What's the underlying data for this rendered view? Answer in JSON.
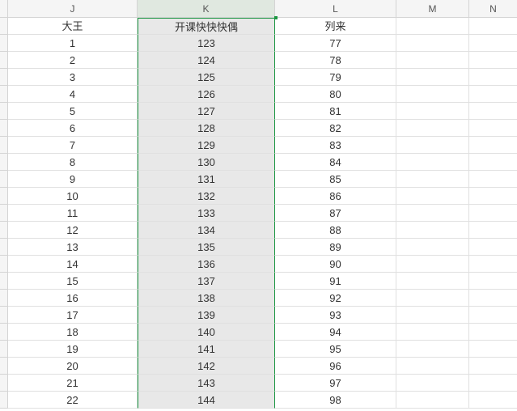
{
  "columns": [
    {
      "letter": "J",
      "selected": false
    },
    {
      "letter": "K",
      "selected": true
    },
    {
      "letter": "L",
      "selected": false
    },
    {
      "letter": "M",
      "selected": false
    },
    {
      "letter": "N",
      "selected": false
    }
  ],
  "headers": {
    "J": "大王",
    "K": "开课快快快偶",
    "L": "列来",
    "M": "",
    "N": ""
  },
  "rows": [
    {
      "J": "1",
      "K": "123",
      "L": "77"
    },
    {
      "J": "2",
      "K": "124",
      "L": "78"
    },
    {
      "J": "3",
      "K": "125",
      "L": "79"
    },
    {
      "J": "4",
      "K": "126",
      "L": "80"
    },
    {
      "J": "5",
      "K": "127",
      "L": "81"
    },
    {
      "J": "6",
      "K": "128",
      "L": "82"
    },
    {
      "J": "7",
      "K": "129",
      "L": "83"
    },
    {
      "J": "8",
      "K": "130",
      "L": "84"
    },
    {
      "J": "9",
      "K": "131",
      "L": "85"
    },
    {
      "J": "10",
      "K": "132",
      "L": "86"
    },
    {
      "J": "11",
      "K": "133",
      "L": "87"
    },
    {
      "J": "12",
      "K": "134",
      "L": "88"
    },
    {
      "J": "13",
      "K": "135",
      "L": "89"
    },
    {
      "J": "14",
      "K": "136",
      "L": "90"
    },
    {
      "J": "15",
      "K": "137",
      "L": "91"
    },
    {
      "J": "16",
      "K": "138",
      "L": "92"
    },
    {
      "J": "17",
      "K": "139",
      "L": "93"
    },
    {
      "J": "18",
      "K": "140",
      "L": "94"
    },
    {
      "J": "19",
      "K": "141",
      "L": "95"
    },
    {
      "J": "20",
      "K": "142",
      "L": "96"
    },
    {
      "J": "21",
      "K": "143",
      "L": "97"
    },
    {
      "J": "22",
      "K": "144",
      "L": "98"
    }
  ],
  "selected_column": "K"
}
